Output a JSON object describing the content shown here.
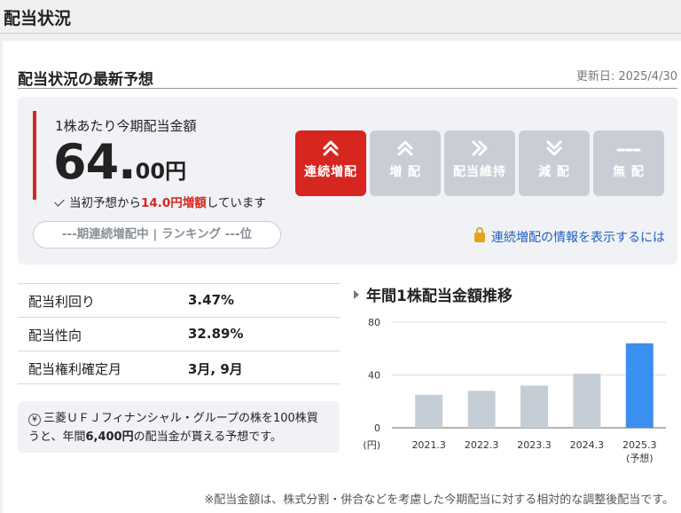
{
  "page": {
    "title": "配当状況"
  },
  "section": {
    "title": "配当状況の最新予想",
    "updated": "更新日: 2025/4/30"
  },
  "forecast": {
    "label": "1株あたり今期配当金額",
    "amount_int": "64.",
    "amount_dec": "00円",
    "note_pre": "当初予想から",
    "note_em": "14.0円増額",
    "note_post": "しています",
    "rank": "---期連続増配中 | ランキング ---位",
    "lock_link": "連続増配の情報を表示するには"
  },
  "badges": [
    {
      "label": "連続増配",
      "icon": "double-chevron-up-icon",
      "active": true
    },
    {
      "label": "増 配",
      "icon": "chevron-up-icon",
      "active": false
    },
    {
      "label": "配当維持",
      "icon": "double-chevron-right-icon",
      "active": false
    },
    {
      "label": "減 配",
      "icon": "chevron-down-icon",
      "active": false
    },
    {
      "label": "無 配",
      "icon": "dashes-icon",
      "active": false
    }
  ],
  "stats": [
    {
      "key": "配当利回り",
      "value": "3.47%"
    },
    {
      "key": "配当性向",
      "value": "32.89%"
    },
    {
      "key": "配当権利確定月",
      "value": "3月, 9月"
    }
  ],
  "note": {
    "yen": "¥",
    "pre": "三菱ＵＦＪフィナンシャル・グループの株を100株買うと、年間",
    "em": "6,400円",
    "post": "の配当金が貰える予想です。"
  },
  "footnote": "※配当金額は、株式分割・併合などを考慮した今期配当に対する相対的な調整後配当です。",
  "colors": {
    "accent_red": "#d7261f",
    "bar_gray": "#c5ced6",
    "bar_blue": "#3b8ff0",
    "link_blue": "#1f5fbf"
  },
  "chart_data": {
    "type": "bar",
    "title": "年間1株配当金額推移",
    "categories": [
      "2021.3",
      "2022.3",
      "2023.3",
      "2024.3",
      "2025.3"
    ],
    "category_sublabels": [
      "",
      "",
      "",
      "",
      "(予想)"
    ],
    "values": [
      25,
      28,
      32,
      41,
      64
    ],
    "highlight_index": 4,
    "yticks": [
      0,
      40,
      80
    ],
    "ylim": [
      0,
      80
    ],
    "yunit": "(円)",
    "grid": true
  }
}
